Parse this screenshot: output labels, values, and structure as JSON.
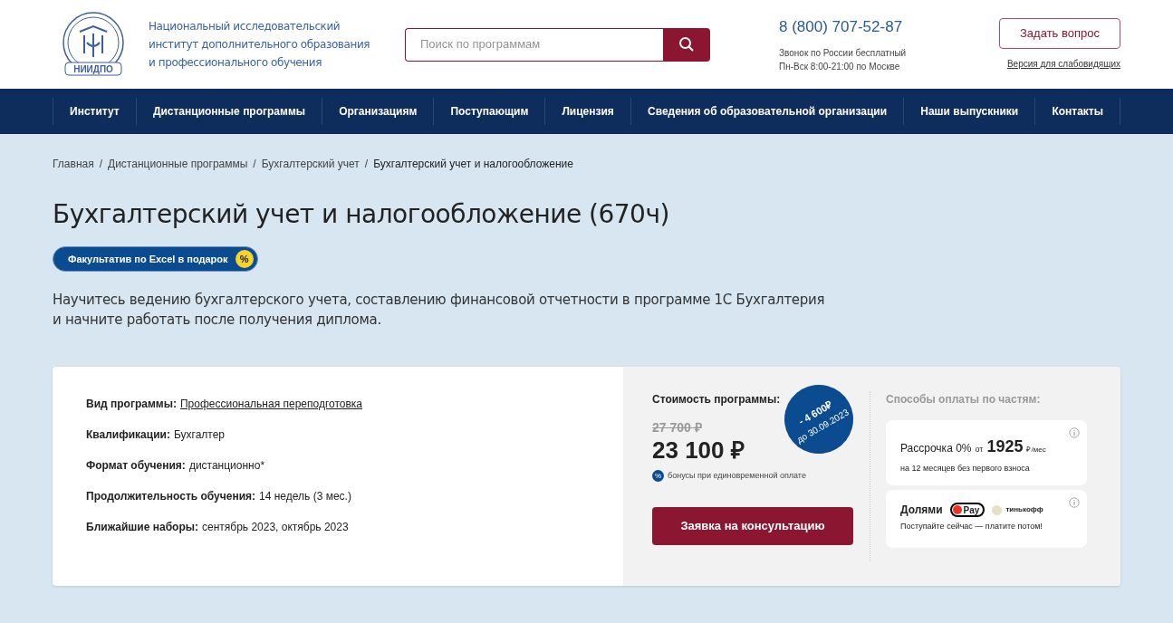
{
  "header": {
    "logo_text": "НИИДПО",
    "org_name": "Национальный исследовательский институт дополнительного образования и профессионального обучения",
    "search": {
      "placeholder": "Поиск по программам"
    },
    "phone": "8 (800) 707-52-87",
    "phone_notes": [
      "Звонок по России бесплатный",
      "Пн-Вск 8:00-21:00 по Москве"
    ],
    "ask_button": "Задать вопрос",
    "accessibility_link": "Версия для слабовидящих"
  },
  "nav": [
    "Институт",
    "Дистанционные программы",
    "Организациям",
    "Поступающим",
    "Лицензия",
    "Сведения об образовательной организации",
    "Наши выпускники",
    "Контакты"
  ],
  "breadcrumbs": [
    "Главная",
    "Дистанционные программы",
    "Бухгалтерский учет",
    "Бухгалтерский учет и налогообложение"
  ],
  "breadcrumb_separator": "/",
  "title": "Бухгалтерский учет и налогообложение (670ч)",
  "promo_badge": {
    "label": "Факультатив по Excel в подарок",
    "icon": "%"
  },
  "description": [
    "Научитесь ведению бухгалтерского учета, составлению финансовой отчетности в программе 1С Бухгалтерия",
    "и начните работать после получения диплома."
  ],
  "details": [
    {
      "label": "Вид программы:",
      "value": "Профессиональная переподготовка",
      "kind": "link"
    },
    {
      "label": "Квалификации:",
      "value": "Бухгалтер",
      "kind": "text"
    },
    {
      "label": "Формат обучения:",
      "value": "дистанционно*",
      "kind": "text"
    },
    {
      "label": "Продолжительность обучения:",
      "value": "14 недель (3 мес.)",
      "kind": "text"
    },
    {
      "label": "Ближайшие наборы:",
      "value": "сентябрь 2023, октябрь 2023",
      "kind": "text"
    }
  ],
  "price": {
    "heading": "Стоимость программы:",
    "old": "27 700 ₽",
    "current": "23 100 ₽",
    "discount": "- 4 600₽",
    "discount_until": "до 30.09.2023",
    "bonus_icon": "%",
    "bonus": "бонусы при единовременной оплате",
    "button": "Заявка на консультацию"
  },
  "installments": {
    "heading": "Способы оплаты по частям:",
    "plans": [
      {
        "kind": "installment",
        "title": "Рассрочка 0%",
        "from": "от",
        "amount": "1925",
        "unit": "₽/мес",
        "note": "на 12 месяцев без первого взноса"
      },
      {
        "kind": "split",
        "title": "Долями",
        "pay": "Pay",
        "bank": "тинькофф",
        "note": "Поступайте сейчас — платите потом!"
      }
    ]
  }
}
